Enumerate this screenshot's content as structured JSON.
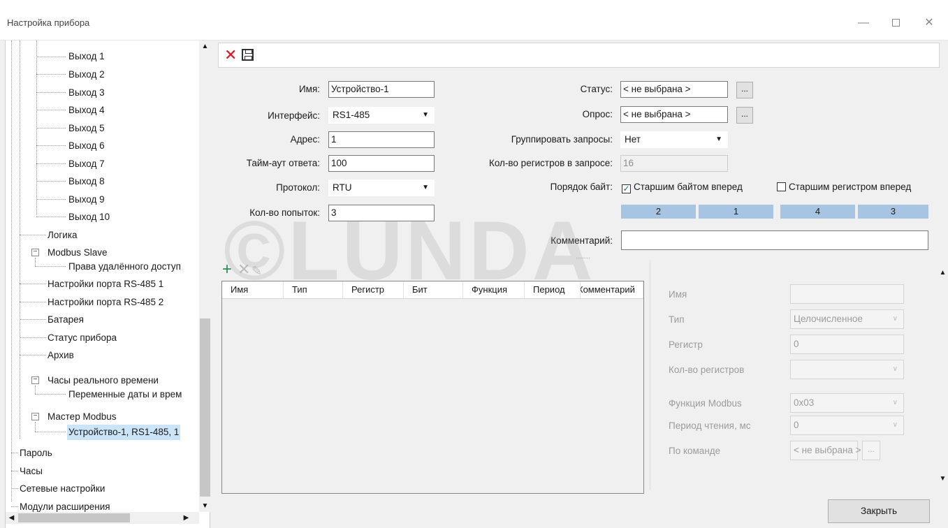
{
  "window": {
    "title": "Настройка прибора",
    "controls": {
      "minimize": "—",
      "close": "✕"
    }
  },
  "tree": {
    "items": [
      {
        "label": "Выход 1"
      },
      {
        "label": "Выход 2"
      },
      {
        "label": "Выход 3"
      },
      {
        "label": "Выход 4"
      },
      {
        "label": "Выход 5"
      },
      {
        "label": "Выход 6"
      },
      {
        "label": "Выход 7"
      },
      {
        "label": "Выход 8"
      },
      {
        "label": "Выход 9"
      },
      {
        "label": "Выход 10"
      },
      {
        "label": "Логика"
      },
      {
        "label": "Modbus Slave"
      },
      {
        "label": "Права удалённого доступ"
      },
      {
        "label": "Настройки порта RS-485 1"
      },
      {
        "label": "Настройки порта RS-485 2"
      },
      {
        "label": "Батарея"
      },
      {
        "label": "Статус прибора"
      },
      {
        "label": "Архив"
      },
      {
        "label": "Часы реального времени"
      },
      {
        "label": "Переменные даты и врем"
      },
      {
        "label": "Мастер Modbus"
      },
      {
        "label": "Устройство-1, RS1-485, 1"
      },
      {
        "label": "Пароль"
      },
      {
        "label": "Часы"
      },
      {
        "label": "Сетевые настройки"
      },
      {
        "label": "Модули расширения"
      }
    ],
    "selected_index": 21,
    "expander_minus": "−"
  },
  "form": {
    "name_label": "Имя:",
    "name_value": "Устройство-1",
    "interface_label": "Интерфейс:",
    "interface_value": "RS1-485",
    "address_label": "Адрес:",
    "address_value": "1",
    "timeout_label": "Тайм-аут ответа:",
    "timeout_value": "100",
    "protocol_label": "Протокол:",
    "protocol_value": "RTU",
    "attempts_label": "Кол-во попыток:",
    "attempts_value": "3",
    "status_label": "Статус:",
    "status_value": "< не выбрана >",
    "poll_label": "Опрос:",
    "poll_value": "< не выбрана >",
    "group_label": "Группировать запросы:",
    "group_value": "Нет",
    "regcount_label": "Кол-во регистров в запросе:",
    "regcount_value": "16",
    "byteorder_label": "Порядок байт:",
    "high_byte_first": "Старшим байтом вперед",
    "high_byte_checked": true,
    "high_reg_first": "Старшим регистром вперед",
    "high_reg_checked": false,
    "byte_cells": [
      "2",
      "1",
      "4",
      "3"
    ],
    "comment_label": "Комментарий:",
    "comment_value": "",
    "dots": "..."
  },
  "table": {
    "columns": [
      "Имя",
      "Тип",
      "Регистр",
      "Бит",
      "Функция",
      "Период",
      "Комментарий"
    ]
  },
  "props": {
    "name_label": "Имя",
    "type_label": "Тип",
    "type_value": "Целочисленное",
    "register_label": "Регистр",
    "register_value": "0",
    "regcount_label": "Кол-во регистров",
    "function_label": "Функция Modbus",
    "function_value": "0x03",
    "period_label": "Период чтения, мс",
    "period_value": "0",
    "command_label": "По команде",
    "command_value": "< не выбрана >"
  },
  "footer": {
    "close_label": "Закрыть"
  },
  "watermark": "©LUNDA",
  "colors": {
    "selection": "#cce4f7",
    "byte_cell": "#a8c4e3",
    "delete_red": "#e81123",
    "add_green": "#2e8b57"
  }
}
